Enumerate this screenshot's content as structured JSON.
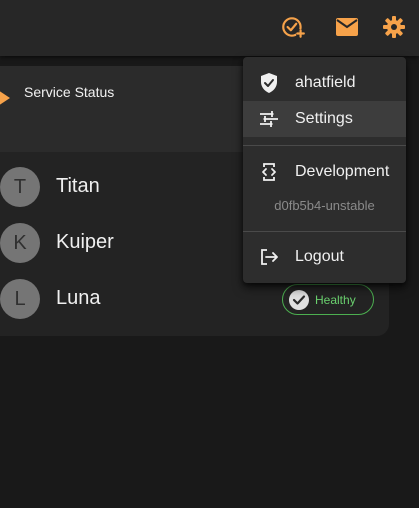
{
  "topbar": {
    "icons": [
      "add-check-icon",
      "mail-icon",
      "gear-icon"
    ],
    "accent_color": "#f6a24a"
  },
  "card": {
    "title": "Service Status"
  },
  "services": [
    {
      "initial": "T",
      "name": "Titan"
    },
    {
      "initial": "K",
      "name": "Kuiper"
    },
    {
      "initial": "L",
      "name": "Luna",
      "status": "Healthy"
    }
  ],
  "status_color": "#4caf50",
  "menu": {
    "user": "ahatfield",
    "settings": "Settings",
    "development": "Development",
    "version": "d0fb5b4-unstable",
    "logout": "Logout"
  }
}
